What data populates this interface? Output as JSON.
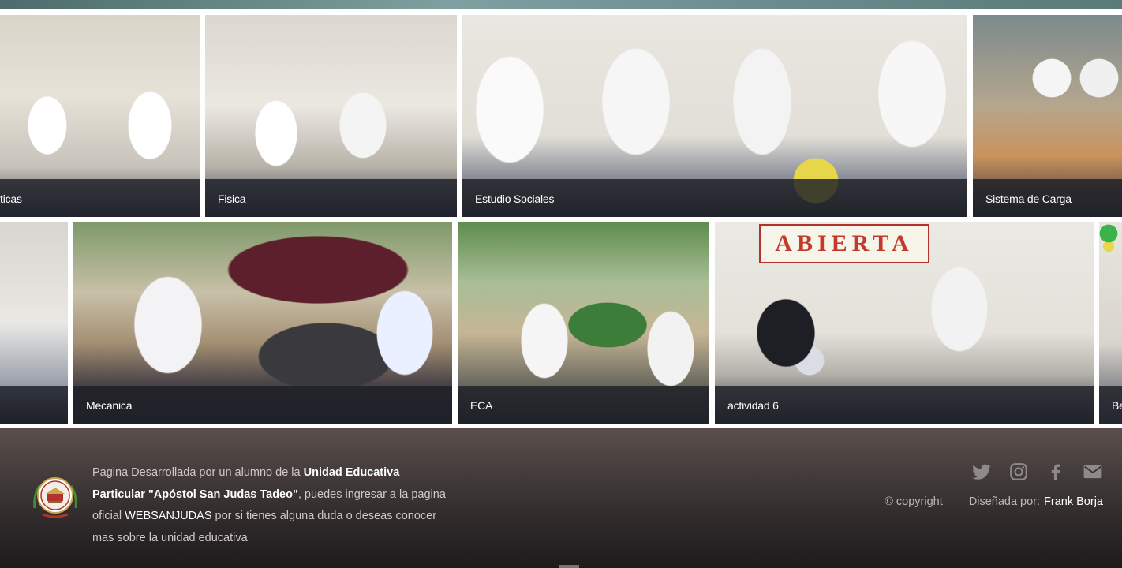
{
  "gallery": {
    "row1": [
      {
        "caption": "ticas"
      },
      {
        "caption": "Fisica"
      },
      {
        "caption": "Estudio Sociales"
      },
      {
        "caption": "Sistema de Carga"
      }
    ],
    "row2": [
      {
        "caption": ""
      },
      {
        "caption": "Mecanica"
      },
      {
        "caption": "ECA"
      },
      {
        "caption": "actividad 6"
      },
      {
        "caption": "Be"
      }
    ],
    "banner_text": "ABIERTA"
  },
  "footer": {
    "about": {
      "t1": "Pagina Desarrollada por un alumno de la ",
      "school": "Unidad Educativa Particular \"Apóstol San Judas Tadeo\"",
      "t2": ", puedes ingresar a la pagina oficial ",
      "link": "WEBSANJUDAS",
      "t3": " por si tienes alguna duda o deseas conocer mas sobre la unidad educativa"
    },
    "social_icons": [
      "twitter-icon",
      "instagram-icon",
      "facebook-icon",
      "mail-icon"
    ],
    "copyright": "© copyright",
    "designed_by_label": "Diseñada por:",
    "designer": "Frank Borja"
  }
}
